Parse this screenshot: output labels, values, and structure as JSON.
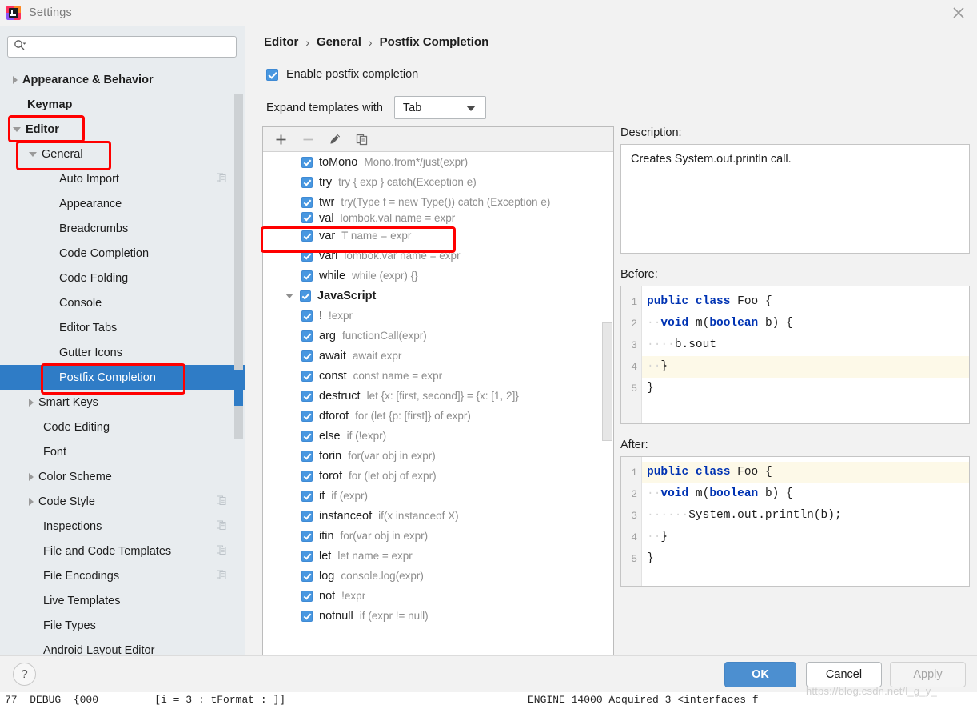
{
  "window": {
    "title": "Settings",
    "logo_icon": "intellij-idea-logo",
    "close_icon": "close-icon"
  },
  "sidebar": {
    "search": {
      "value": "",
      "placeholder": "",
      "icon": "search-icon"
    },
    "items": [
      {
        "label": "Appearance & Behavior",
        "indent": 0,
        "arrow": "right",
        "bold": true,
        "selected": false,
        "copy": false
      },
      {
        "label": "Keymap",
        "indent": 0,
        "arrow": "none",
        "bold": true,
        "selected": false,
        "copy": false
      },
      {
        "label": "Editor",
        "indent": 0,
        "arrow": "down",
        "bold": true,
        "selected": false,
        "copy": false
      },
      {
        "label": "General",
        "indent": 1,
        "arrow": "down",
        "bold": false,
        "selected": false,
        "copy": false
      },
      {
        "label": "Auto Import",
        "indent": 2,
        "arrow": "none",
        "bold": false,
        "selected": false,
        "copy": true
      },
      {
        "label": "Appearance",
        "indent": 2,
        "arrow": "none",
        "bold": false,
        "selected": false,
        "copy": false
      },
      {
        "label": "Breadcrumbs",
        "indent": 2,
        "arrow": "none",
        "bold": false,
        "selected": false,
        "copy": false
      },
      {
        "label": "Code Completion",
        "indent": 2,
        "arrow": "none",
        "bold": false,
        "selected": false,
        "copy": false
      },
      {
        "label": "Code Folding",
        "indent": 2,
        "arrow": "none",
        "bold": false,
        "selected": false,
        "copy": false
      },
      {
        "label": "Console",
        "indent": 2,
        "arrow": "none",
        "bold": false,
        "selected": false,
        "copy": false
      },
      {
        "label": "Editor Tabs",
        "indent": 2,
        "arrow": "none",
        "bold": false,
        "selected": false,
        "copy": false
      },
      {
        "label": "Gutter Icons",
        "indent": 2,
        "arrow": "none",
        "bold": false,
        "selected": false,
        "copy": false
      },
      {
        "label": "Postfix Completion",
        "indent": 2,
        "arrow": "none",
        "bold": false,
        "selected": true,
        "copy": false
      },
      {
        "label": "Smart Keys",
        "indent": 1,
        "arrow": "right",
        "bold": false,
        "selected": false,
        "copy": false
      },
      {
        "label": "Code Editing",
        "indent": 1,
        "arrow": "none",
        "bold": false,
        "selected": false,
        "copy": false
      },
      {
        "label": "Font",
        "indent": 1,
        "arrow": "none",
        "bold": false,
        "selected": false,
        "copy": false
      },
      {
        "label": "Color Scheme",
        "indent": 1,
        "arrow": "right",
        "bold": false,
        "selected": false,
        "copy": false
      },
      {
        "label": "Code Style",
        "indent": 1,
        "arrow": "right",
        "bold": false,
        "selected": false,
        "copy": true
      },
      {
        "label": "Inspections",
        "indent": 1,
        "arrow": "none",
        "bold": false,
        "selected": false,
        "copy": true
      },
      {
        "label": "File and Code Templates",
        "indent": 1,
        "arrow": "none",
        "bold": false,
        "selected": false,
        "copy": true
      },
      {
        "label": "File Encodings",
        "indent": 1,
        "arrow": "none",
        "bold": false,
        "selected": false,
        "copy": true
      },
      {
        "label": "Live Templates",
        "indent": 1,
        "arrow": "none",
        "bold": false,
        "selected": false,
        "copy": false
      },
      {
        "label": "File Types",
        "indent": 1,
        "arrow": "none",
        "bold": false,
        "selected": false,
        "copy": false
      },
      {
        "label": "Android Layout Editor",
        "indent": 1,
        "arrow": "none",
        "bold": false,
        "selected": false,
        "copy": false
      }
    ]
  },
  "main": {
    "breadcrumb": {
      "parts": [
        "Editor",
        "General",
        "Postfix Completion"
      ],
      "separator": "›"
    },
    "enable_checkbox": {
      "label": "Enable postfix completion",
      "checked": true
    },
    "expand_with": {
      "label": "Expand templates with",
      "value": "Tab",
      "caret_icon": "chevron-down-icon"
    },
    "toolbar": {
      "add_icon": "plus-icon",
      "remove_icon": "minus-icon",
      "edit_icon": "pencil-icon",
      "duplicate_icon": "copy-icon"
    },
    "templates": [
      {
        "indent": 2,
        "key": "toMono",
        "desc": "Mono.from*/just(expr)",
        "checked": true,
        "group": false,
        "clipped": false
      },
      {
        "indent": 2,
        "key": "try",
        "desc": "try { exp } catch(Exception e)",
        "checked": true,
        "group": false,
        "clipped": false
      },
      {
        "indent": 2,
        "key": "twr",
        "desc": "try(Type f = new Type()) catch (Exception e)",
        "checked": true,
        "group": false,
        "clipped": false
      },
      {
        "indent": 2,
        "key": "val",
        "desc": "lombok.val name = expr",
        "checked": true,
        "group": false,
        "clipped": true
      },
      {
        "indent": 2,
        "key": "var",
        "desc": "T name = expr",
        "checked": true,
        "group": false,
        "clipped": false
      },
      {
        "indent": 2,
        "key": "varl",
        "desc": "lombok.var name = expr",
        "checked": true,
        "group": false,
        "clipped": false
      },
      {
        "indent": 2,
        "key": "while",
        "desc": "while (expr) {}",
        "checked": true,
        "group": false,
        "clipped": false
      },
      {
        "indent": 0,
        "key": "JavaScript",
        "desc": "",
        "checked": true,
        "group": true,
        "clipped": false
      },
      {
        "indent": 2,
        "key": "!",
        "desc": "!expr",
        "checked": true,
        "group": false,
        "clipped": false
      },
      {
        "indent": 2,
        "key": "arg",
        "desc": "functionCall(expr)",
        "checked": true,
        "group": false,
        "clipped": false
      },
      {
        "indent": 2,
        "key": "await",
        "desc": "await expr",
        "checked": true,
        "group": false,
        "clipped": false
      },
      {
        "indent": 2,
        "key": "const",
        "desc": "const name = expr",
        "checked": true,
        "group": false,
        "clipped": false
      },
      {
        "indent": 2,
        "key": "destruct",
        "desc": "let {x: [first, second]} = {x: [1, 2]}",
        "checked": true,
        "group": false,
        "clipped": false
      },
      {
        "indent": 2,
        "key": "dforof",
        "desc": "for (let {p: [first]} of expr)",
        "checked": true,
        "group": false,
        "clipped": false
      },
      {
        "indent": 2,
        "key": "else",
        "desc": "if (!expr)",
        "checked": true,
        "group": false,
        "clipped": false
      },
      {
        "indent": 2,
        "key": "forin",
        "desc": "for(var obj in expr)",
        "checked": true,
        "group": false,
        "clipped": false
      },
      {
        "indent": 2,
        "key": "forof",
        "desc": "for (let obj of expr)",
        "checked": true,
        "group": false,
        "clipped": false
      },
      {
        "indent": 2,
        "key": "if",
        "desc": "if (expr)",
        "checked": true,
        "group": false,
        "clipped": false
      },
      {
        "indent": 2,
        "key": "instanceof",
        "desc": "if(x instanceof X)",
        "checked": true,
        "group": false,
        "clipped": false
      },
      {
        "indent": 2,
        "key": "itin",
        "desc": "for(var obj in expr)",
        "checked": true,
        "group": false,
        "clipped": false
      },
      {
        "indent": 2,
        "key": "let",
        "desc": "let name = expr",
        "checked": true,
        "group": false,
        "clipped": false
      },
      {
        "indent": 2,
        "key": "log",
        "desc": "console.log(expr)",
        "checked": true,
        "group": false,
        "clipped": false
      },
      {
        "indent": 2,
        "key": "not",
        "desc": "!expr",
        "checked": true,
        "group": false,
        "clipped": false
      },
      {
        "indent": 2,
        "key": "notnull",
        "desc": "if (expr != null)",
        "checked": true,
        "group": false,
        "clipped": false
      }
    ],
    "detail": {
      "description_label": "Description:",
      "description_text": "Creates System.out.println call.",
      "before_label": "Before:",
      "after_label": "After:",
      "before_code": [
        {
          "n": "1",
          "text": "public class Foo {",
          "hl": false
        },
        {
          "n": "2",
          "text": "  void m(boolean b) {",
          "hl": false
        },
        {
          "n": "3",
          "text": "    b.sout",
          "hl": false
        },
        {
          "n": "4",
          "text": "  }",
          "hl": true
        },
        {
          "n": "5",
          "text": "}",
          "hl": false
        }
      ],
      "after_code": [
        {
          "n": "1",
          "text": "public class Foo {",
          "hl": true
        },
        {
          "n": "2",
          "text": "  void m(boolean b) {",
          "hl": false
        },
        {
          "n": "3",
          "text": "      System.out.println(b);",
          "hl": false
        },
        {
          "n": "4",
          "text": "  }",
          "hl": false
        },
        {
          "n": "5",
          "text": "}",
          "hl": false
        }
      ]
    }
  },
  "footer": {
    "help_label": "?",
    "ok_label": "OK",
    "cancel_label": "Cancel",
    "apply_label": "Apply",
    "watermark": "https://blog.csdn.net/l_g_y_"
  },
  "background": {
    "left_text": "77  DEBUG  {000         [i = 3 : tFormat : ]]",
    "right_text": "ENGINE 14000 Acquired 3 <interfaces f"
  },
  "colors": {
    "accent": "#2f7cc6",
    "checkbox": "#4897e0",
    "annotation": "#ff0000",
    "selection_text": "#ffffff",
    "keyword": "#0033b3"
  }
}
